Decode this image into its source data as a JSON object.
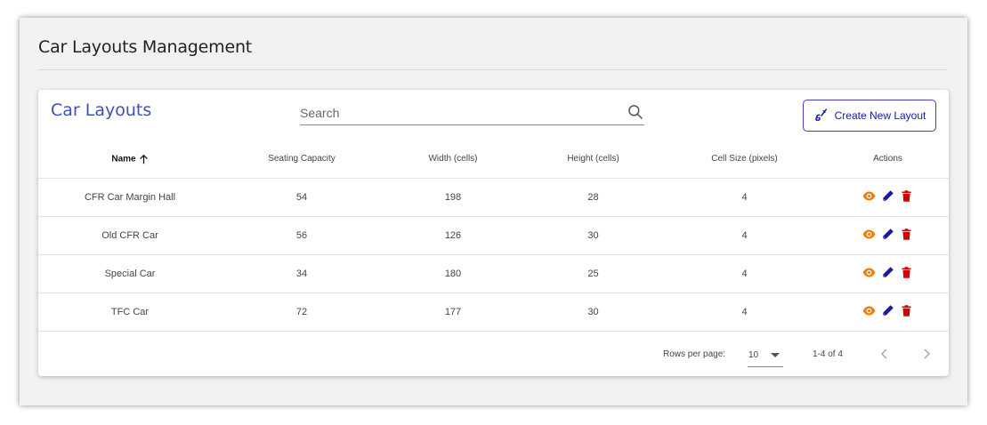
{
  "page": {
    "title": "Car Layouts Management"
  },
  "card": {
    "title": "Car Layouts"
  },
  "search": {
    "placeholder": "Search",
    "value": ""
  },
  "create_button": {
    "label": "Create New Layout"
  },
  "table": {
    "headers": [
      "Name",
      "Seating Capacity",
      "Width (cells)",
      "Height (cells)",
      "Cell Size (pixels)",
      "Actions"
    ],
    "rows": [
      [
        "CFR Car Margin Hall",
        "54",
        "198",
        "28",
        "4"
      ],
      [
        "Old CFR Car",
        "56",
        "126",
        "30",
        "4"
      ],
      [
        "Special Car",
        "34",
        "180",
        "25",
        "4"
      ],
      [
        "TFC Car",
        "72",
        "177",
        "30",
        "4"
      ]
    ]
  },
  "footer": {
    "rows_per_page_label": "Rows per page:",
    "rows_per_page_value": "10",
    "range": "1-4 of 4"
  },
  "colors": {
    "accent": "#3f51b5",
    "view": "#f57c00",
    "edit": "#1a1aa0",
    "delete": "#d50000"
  }
}
